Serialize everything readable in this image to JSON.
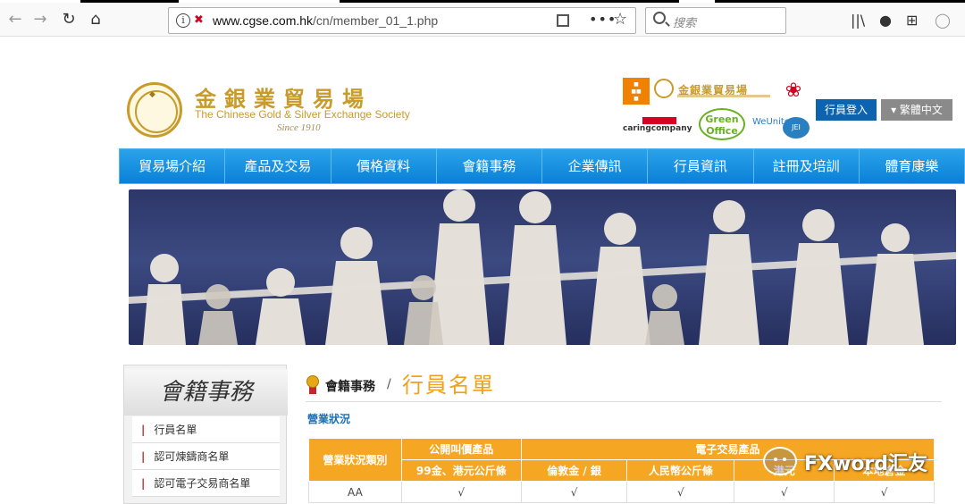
{
  "browser": {
    "url_host": "www.cgse.com.hk",
    "url_path": "/cn/member_01_1.php",
    "search_placeholder": "搜索"
  },
  "site": {
    "logo_cn": "金銀業貿易場",
    "logo_en": "The Chinese Gold & Silver Exchange Society",
    "logo_since": "Since 1910",
    "badge_text": "金銀業貿易場",
    "caring_label": "caringcompany",
    "green_label": "Green Office",
    "weunite_label": "WeUnite",
    "weunite_badge": "JEI",
    "login_label": "行員登入",
    "lang_label": "繁體中文"
  },
  "menu": [
    "貿易場介紹",
    "產品及交易",
    "價格資料",
    "會籍事務",
    "企業傳訊",
    "行員資訊",
    "註冊及培訓",
    "體育康樂"
  ],
  "sidebar": {
    "title": "會籍事務",
    "items": [
      "行員名單",
      "認可煉鑄商名單",
      "認可電子交易商名單"
    ]
  },
  "main": {
    "crumb_parent": "會籍事務",
    "crumb_sep": "/",
    "crumb_current": "行員名單",
    "subheading": "營業狀況"
  },
  "table": {
    "col_category": "營業狀況類別",
    "group_open": "公開叫價產品",
    "group_elec": "電子交易產品",
    "sub_cols": [
      "99金、港元公斤條",
      "倫敦金 / 銀",
      "人民幣公斤條",
      "港元",
      "本地倉金"
    ],
    "rows": [
      {
        "category": "AA",
        "cells": [
          "√",
          "√",
          "√",
          "√",
          "√"
        ]
      }
    ]
  },
  "watermark": "FXword汇友"
}
